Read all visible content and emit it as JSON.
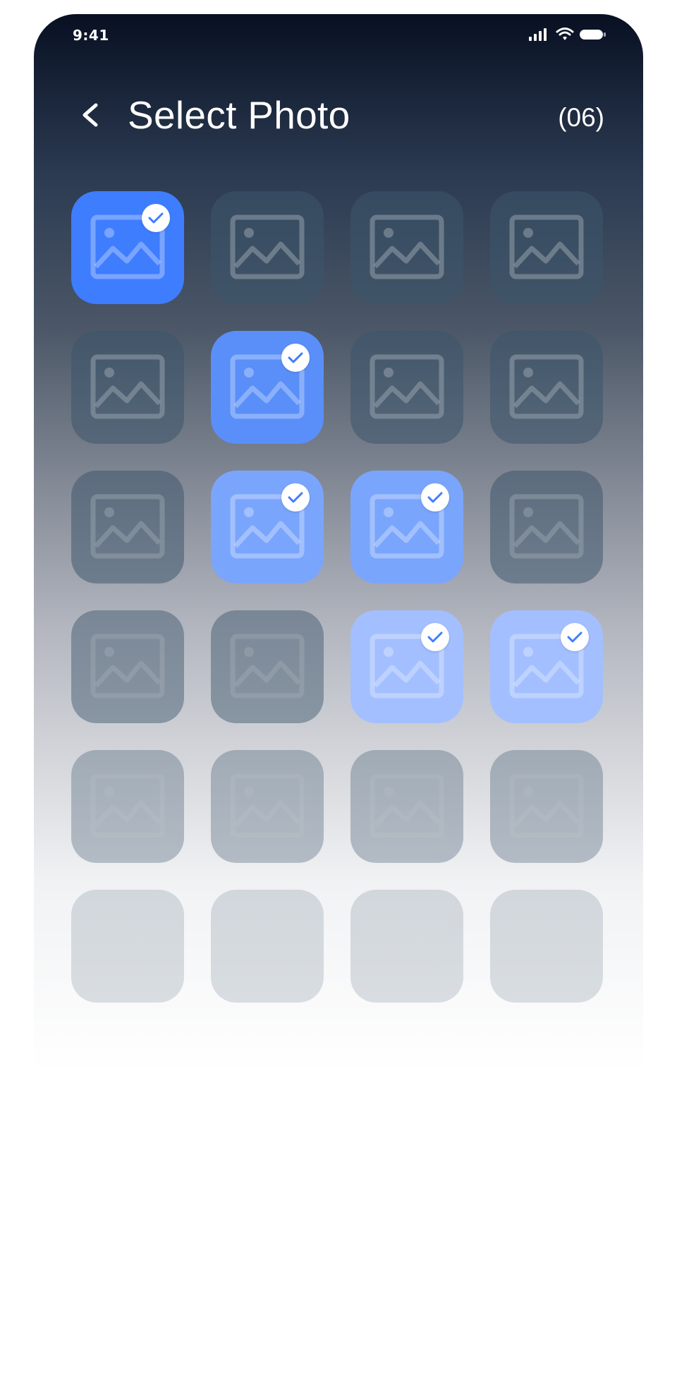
{
  "status_bar": {
    "time": "9:41"
  },
  "header": {
    "title": "Select Photo",
    "count": "(06)"
  },
  "grid": {
    "rows": [
      [
        true,
        false,
        false,
        false
      ],
      [
        false,
        true,
        false,
        false
      ],
      [
        false,
        true,
        true,
        false
      ],
      [
        false,
        false,
        true,
        true
      ],
      [
        false,
        false,
        false,
        false
      ],
      [
        false,
        false,
        false,
        false
      ]
    ]
  },
  "colors": {
    "accent": "#3f7dff",
    "selected_light": "#a9c2ff",
    "placeholder_bg": "#3d556c"
  },
  "icons": {
    "back": "chevron-left-icon",
    "placeholder": "image-icon",
    "selected": "checkmark-icon",
    "signal": "signal-icon",
    "wifi": "wifi-icon",
    "battery": "battery-icon"
  }
}
